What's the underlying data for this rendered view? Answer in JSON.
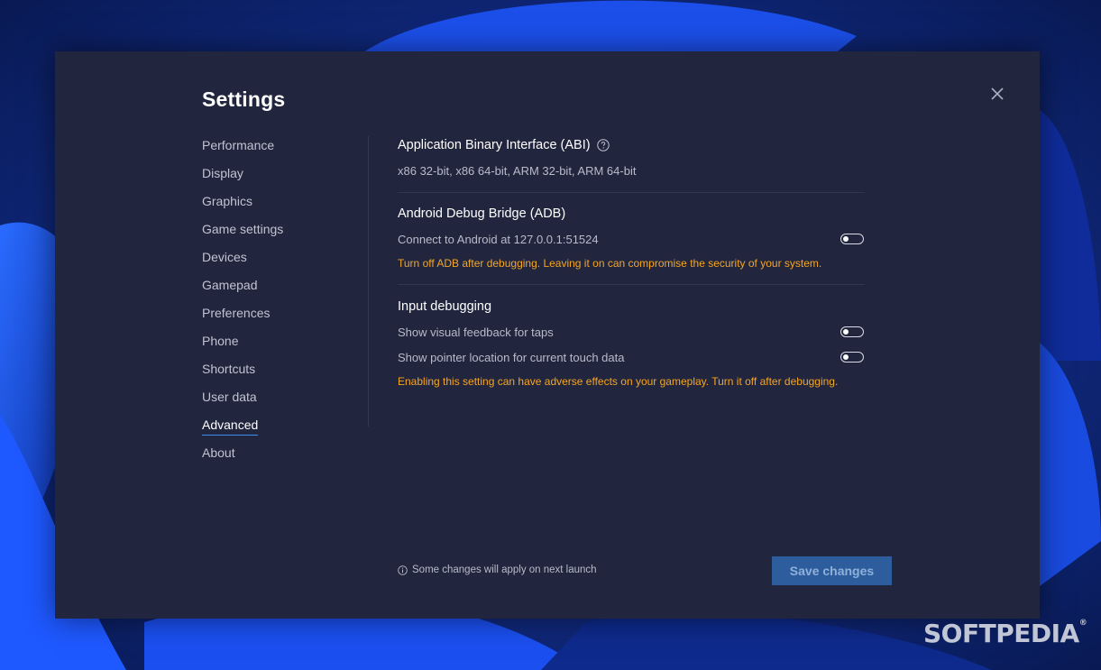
{
  "dialog": {
    "title": "Settings",
    "close_icon": "close-icon"
  },
  "sidebar": {
    "items": [
      {
        "label": "Performance"
      },
      {
        "label": "Display"
      },
      {
        "label": "Graphics"
      },
      {
        "label": "Game settings"
      },
      {
        "label": "Devices"
      },
      {
        "label": "Gamepad"
      },
      {
        "label": "Preferences"
      },
      {
        "label": "Phone"
      },
      {
        "label": "Shortcuts"
      },
      {
        "label": "User data"
      },
      {
        "label": "Advanced",
        "active": true
      },
      {
        "label": "About"
      }
    ]
  },
  "abi": {
    "title": "Application Binary Interface (ABI)",
    "value": "x86 32-bit, x86 64-bit, ARM 32-bit, ARM 64-bit"
  },
  "adb": {
    "title": "Android Debug Bridge (ADB)",
    "connect_label": "Connect to Android at 127.0.0.1:51524",
    "connect_enabled": false,
    "warning": "Turn off ADB after debugging. Leaving it on can compromise the security of your system."
  },
  "input_debugging": {
    "title": "Input debugging",
    "taps_label": "Show visual feedback for taps",
    "taps_enabled": false,
    "pointer_label": "Show pointer location for current touch data",
    "pointer_enabled": false,
    "warning": "Enabling this setting can have adverse effects on your gameplay. Turn it off after debugging."
  },
  "footer": {
    "note": "Some changes will apply on next launch",
    "save_label": "Save changes"
  },
  "colors": {
    "dialog_bg": "#21253d",
    "warning": "#f5a623",
    "accent": "#3d8ef0",
    "save_button": "#2d5d9d"
  },
  "watermark": "SOFTPEDIA"
}
